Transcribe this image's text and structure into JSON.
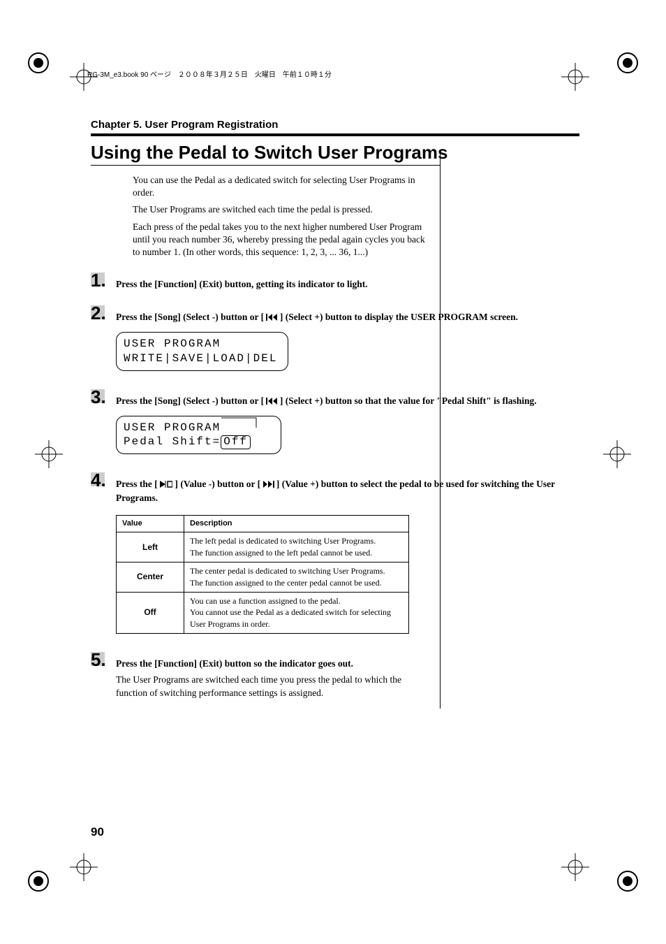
{
  "header_line": "RG-3M_e3.book  90 ページ　２００８年３月２５日　火曜日　午前１０時１分",
  "chapter": "Chapter 5. User Program Registration",
  "title": "Using the Pedal to Switch User Programs",
  "intro": {
    "p1": "You can use the Pedal as a dedicated switch for selecting User Programs in order.",
    "p2": "The User Programs are switched each time the pedal is pressed.",
    "p3": "Each press of the pedal takes you to the next higher numbered User Program until you reach number 36, whereby pressing the pedal again cycles you back to number 1. (In other words, this sequence: 1, 2, 3, ... 36, 1...)"
  },
  "steps": {
    "s1": {
      "num": "1.",
      "text": "Press the [Function] (Exit) button, getting its indicator to light."
    },
    "s2": {
      "num": "2.",
      "text_a": "Press the [Song] (Select -) button or [ ",
      "text_b": " ] (Select +) button to display the USER PROGRAM screen.",
      "lcd_l1": "USER PROGRAM",
      "lcd_l2": "WRITE|SAVE|LOAD|DEL"
    },
    "s3": {
      "num": "3.",
      "text_a": "Press the [Song] (Select -) button or [ ",
      "text_b": " ] (Select +) button so that the value for \"Pedal Shift\" is flashing.",
      "lcd_l1": "USER PROGRAM",
      "lcd_l2a": " Pedal Shift=",
      "lcd_l2b": "Off"
    },
    "s4": {
      "num": "4.",
      "text_a": "Press the [ ",
      "text_b": " ] (Value -) button or [ ",
      "text_c": " ] (Value +) button to select the pedal to be used for switching the User Programs.",
      "table": {
        "h1": "Value",
        "h2": "Description",
        "rows": [
          {
            "v": "Left",
            "d": "The left pedal is dedicated to switching User Programs.\nThe function assigned to the left pedal cannot be used."
          },
          {
            "v": "Center",
            "d": "The center pedal is dedicated to switching User Programs.\nThe function assigned to the center pedal cannot be used."
          },
          {
            "v": "Off",
            "d": "You can use a function assigned to the pedal.\nYou cannot use the Pedal as a dedicated switch for selecting User Programs in order."
          }
        ]
      }
    },
    "s5": {
      "num": "5.",
      "bold": "Press the [Function] (Exit) button so the indicator goes out.",
      "text": "The User Programs are switched each time you press the pedal to which the function of switching performance settings is assigned."
    }
  },
  "page_number": "90"
}
